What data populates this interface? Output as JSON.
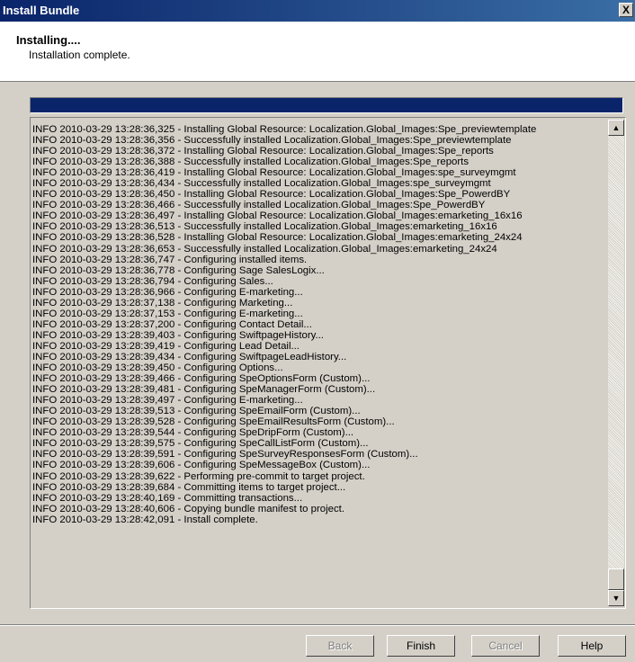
{
  "window": {
    "title": "Install Bundle",
    "close_label": "X"
  },
  "header": {
    "title": "Installing....",
    "subtitle": "Installation complete."
  },
  "progress": {
    "fraction": 1.0,
    "color": "#0a246a"
  },
  "log": {
    "lines": [
      "INFO  2010-03-29 13:28:36,325 - Installing Global Resource: Localization.Global_Images:Spe_previewtemplate",
      "INFO  2010-03-29 13:28:36,356 - Successfully installed Localization.Global_Images:Spe_previewtemplate",
      "INFO  2010-03-29 13:28:36,372 - Installing Global Resource: Localization.Global_Images:Spe_reports",
      "INFO  2010-03-29 13:28:36,388 - Successfully installed Localization.Global_Images:Spe_reports",
      "INFO  2010-03-29 13:28:36,419 - Installing Global Resource: Localization.Global_Images:spe_surveymgmt",
      "INFO  2010-03-29 13:28:36,434 - Successfully installed Localization.Global_Images:spe_surveymgmt",
      "INFO  2010-03-29 13:28:36,450 - Installing Global Resource: Localization.Global_Images:Spe_PowerdBY",
      "INFO  2010-03-29 13:28:36,466 - Successfully installed Localization.Global_Images:Spe_PowerdBY",
      "INFO  2010-03-29 13:28:36,497 - Installing Global Resource: Localization.Global_Images:emarketing_16x16",
      "INFO  2010-03-29 13:28:36,513 - Successfully installed Localization.Global_Images:emarketing_16x16",
      "INFO  2010-03-29 13:28:36,528 - Installing Global Resource: Localization.Global_Images:emarketing_24x24",
      "INFO  2010-03-29 13:28:36,653 - Successfully installed Localization.Global_Images:emarketing_24x24",
      "INFO  2010-03-29 13:28:36,747 - Configuring installed items.",
      "INFO  2010-03-29 13:28:36,778 - Configuring Sage SalesLogix...",
      "INFO  2010-03-29 13:28:36,794 - Configuring Sales...",
      "INFO  2010-03-29 13:28:36,966 - Configuring E-marketing...",
      "INFO  2010-03-29 13:28:37,138 - Configuring Marketing...",
      "INFO  2010-03-29 13:28:37,153 - Configuring E-marketing...",
      "INFO  2010-03-29 13:28:37,200 - Configuring Contact Detail...",
      "INFO  2010-03-29 13:28:39,403 - Configuring SwiftpageHistory...",
      "INFO  2010-03-29 13:28:39,419 - Configuring Lead Detail...",
      "INFO  2010-03-29 13:28:39,434 - Configuring SwiftpageLeadHistory...",
      "INFO  2010-03-29 13:28:39,450 - Configuring Options...",
      "INFO  2010-03-29 13:28:39,466 - Configuring SpeOptionsForm (Custom)...",
      "INFO  2010-03-29 13:28:39,481 - Configuring SpeManagerForm (Custom)...",
      "INFO  2010-03-29 13:28:39,497 - Configuring E-marketing...",
      "INFO  2010-03-29 13:28:39,513 - Configuring SpeEmailForm (Custom)...",
      "INFO  2010-03-29 13:28:39,528 - Configuring SpeEmailResultsForm (Custom)...",
      "INFO  2010-03-29 13:28:39,544 - Configuring SpeDripForm (Custom)...",
      "INFO  2010-03-29 13:28:39,575 - Configuring SpeCallListForm (Custom)...",
      "INFO  2010-03-29 13:28:39,591 - Configuring SpeSurveyResponsesForm (Custom)...",
      "INFO  2010-03-29 13:28:39,606 - Configuring SpeMessageBox (Custom)...",
      "INFO  2010-03-29 13:28:39,622 - Performing pre-commit to target project.",
      "INFO  2010-03-29 13:28:39,684 - Committing items to target project...",
      "INFO  2010-03-29 13:28:40,169 - Committing transactions...",
      "INFO  2010-03-29 13:28:40,606 - Copying bundle manifest to project.",
      "INFO  2010-03-29 13:28:42,091 - Install complete."
    ]
  },
  "scrollbar": {
    "up_glyph": "▲",
    "down_glyph": "▼"
  },
  "buttons": {
    "back": "Back",
    "finish": "Finish",
    "cancel": "Cancel",
    "help": "Help"
  }
}
